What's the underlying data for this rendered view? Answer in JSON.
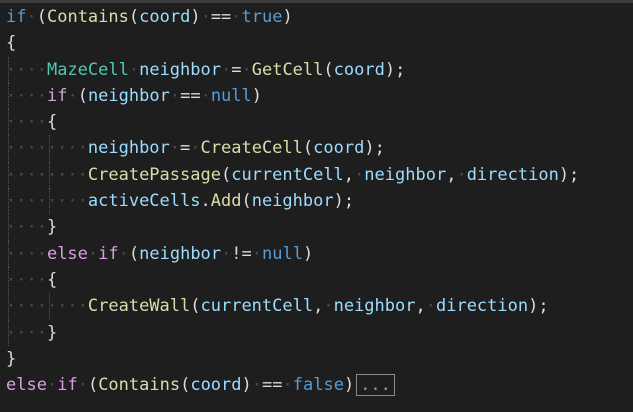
{
  "code": {
    "lines": [
      {
        "tokens": [
          [
            "kw",
            "if"
          ],
          [
            "ws",
            "·"
          ],
          [
            "pn",
            "("
          ],
          [
            "fn",
            "Contains"
          ],
          [
            "pn",
            "("
          ],
          [
            "vr",
            "coord"
          ],
          [
            "pn",
            ")"
          ],
          [
            "ws",
            "·"
          ],
          [
            "pn",
            "=="
          ],
          [
            "ws",
            "·"
          ],
          [
            "kw",
            "true"
          ],
          [
            "pn",
            ")"
          ]
        ]
      },
      {
        "tokens": [
          [
            "pn",
            "{"
          ]
        ]
      },
      {
        "tokens": [
          [
            "ws",
            "····"
          ],
          [
            "ty",
            "MazeCell"
          ],
          [
            "ws",
            "·"
          ],
          [
            "vr",
            "neighbor"
          ],
          [
            "ws",
            "·"
          ],
          [
            "pn",
            "="
          ],
          [
            "ws",
            "·"
          ],
          [
            "fn",
            "GetCell"
          ],
          [
            "pn",
            "("
          ],
          [
            "vr",
            "coord"
          ],
          [
            "pn",
            ");"
          ]
        ]
      },
      {
        "tokens": [
          [
            "ws",
            "····"
          ],
          [
            "kwc",
            "if"
          ],
          [
            "ws",
            "·"
          ],
          [
            "pn",
            "("
          ],
          [
            "vr",
            "neighbor"
          ],
          [
            "ws",
            "·"
          ],
          [
            "pn",
            "=="
          ],
          [
            "ws",
            "·"
          ],
          [
            "kw",
            "null"
          ],
          [
            "pn",
            ")"
          ]
        ]
      },
      {
        "tokens": [
          [
            "ws",
            "····"
          ],
          [
            "pn",
            "{"
          ]
        ]
      },
      {
        "tokens": [
          [
            "ws",
            "········"
          ],
          [
            "vr",
            "neighbor"
          ],
          [
            "ws",
            "·"
          ],
          [
            "pn",
            "="
          ],
          [
            "ws",
            "·"
          ],
          [
            "fn",
            "CreateCell"
          ],
          [
            "pn",
            "("
          ],
          [
            "vr",
            "coord"
          ],
          [
            "pn",
            ");"
          ]
        ]
      },
      {
        "tokens": [
          [
            "ws",
            "········"
          ],
          [
            "fn",
            "CreatePassage"
          ],
          [
            "pn",
            "("
          ],
          [
            "vr",
            "currentCell"
          ],
          [
            "pn",
            ","
          ],
          [
            "ws",
            "·"
          ],
          [
            "vr",
            "neighbor"
          ],
          [
            "pn",
            ","
          ],
          [
            "ws",
            "·"
          ],
          [
            "vr",
            "direction"
          ],
          [
            "pn",
            ");"
          ]
        ]
      },
      {
        "tokens": [
          [
            "ws",
            "········"
          ],
          [
            "vr",
            "activeCells"
          ],
          [
            "pn",
            "."
          ],
          [
            "fn",
            "Add"
          ],
          [
            "pn",
            "("
          ],
          [
            "vr",
            "neighbor"
          ],
          [
            "pn",
            ");"
          ]
        ]
      },
      {
        "tokens": [
          [
            "ws",
            "····"
          ],
          [
            "pn",
            "}"
          ]
        ]
      },
      {
        "tokens": [
          [
            "ws",
            "····"
          ],
          [
            "kwc",
            "else"
          ],
          [
            "ws",
            "·"
          ],
          [
            "kwc",
            "if"
          ],
          [
            "ws",
            "·"
          ],
          [
            "pn",
            "("
          ],
          [
            "vr",
            "neighbor"
          ],
          [
            "ws",
            "·"
          ],
          [
            "pn",
            "!="
          ],
          [
            "ws",
            "·"
          ],
          [
            "kw",
            "null"
          ],
          [
            "pn",
            ")"
          ]
        ]
      },
      {
        "tokens": [
          [
            "ws",
            "····"
          ],
          [
            "pn",
            "{"
          ]
        ]
      },
      {
        "tokens": [
          [
            "ws",
            "········"
          ],
          [
            "fn",
            "CreateWall"
          ],
          [
            "pn",
            "("
          ],
          [
            "vr",
            "currentCell"
          ],
          [
            "pn",
            ","
          ],
          [
            "ws",
            "·"
          ],
          [
            "vr",
            "neighbor"
          ],
          [
            "pn",
            ","
          ],
          [
            "ws",
            "·"
          ],
          [
            "vr",
            "direction"
          ],
          [
            "pn",
            ");"
          ]
        ]
      },
      {
        "tokens": [
          [
            "ws",
            "····"
          ],
          [
            "pn",
            "}"
          ]
        ]
      },
      {
        "tokens": [
          [
            "pn",
            "}"
          ]
        ]
      },
      {
        "tokens": [
          [
            "kwc",
            "else"
          ],
          [
            "ws",
            "·"
          ],
          [
            "kwc",
            "if"
          ],
          [
            "ws",
            "·"
          ],
          [
            "pn",
            "("
          ],
          [
            "fn",
            "Contains"
          ],
          [
            "pn",
            "("
          ],
          [
            "vr",
            "coord"
          ],
          [
            "pn",
            ")"
          ],
          [
            "ws",
            "·"
          ],
          [
            "pn",
            "=="
          ],
          [
            "ws",
            "·"
          ],
          [
            "kw",
            "false"
          ],
          [
            "pn",
            ")"
          ]
        ],
        "collapsed": "..."
      }
    ]
  },
  "colors": {
    "background": "#1e1e1e",
    "keyword": "#569cd6",
    "control_keyword": "#d8a0df",
    "type": "#4ec9b0",
    "method": "#dcdcaa",
    "variable": "#9cdcfe"
  }
}
